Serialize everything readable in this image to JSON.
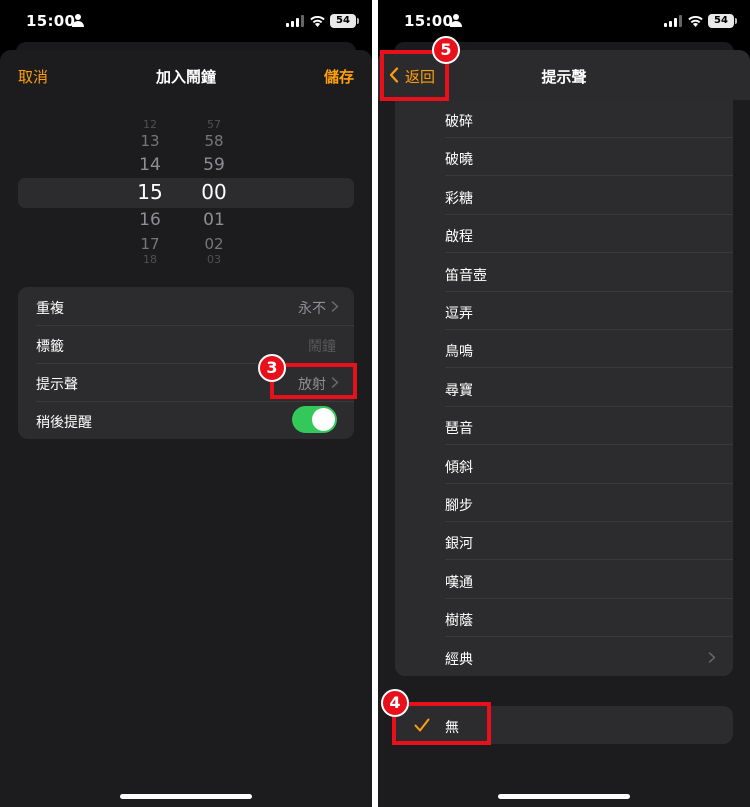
{
  "left": {
    "status": {
      "time": "15:00",
      "battery": "54"
    },
    "nav": {
      "cancel": "取消",
      "title": "加入鬧鐘",
      "save": "儲存"
    },
    "picker": {
      "hours": [
        "12",
        "13",
        "14",
        "15",
        "16",
        "17",
        "18"
      ],
      "minutes": [
        "57",
        "58",
        "59",
        "00",
        "01",
        "02",
        "03"
      ],
      "selected_hour": "15",
      "selected_minute": "00"
    },
    "settings": {
      "repeat": {
        "label": "重複",
        "value": "永不"
      },
      "label_row": {
        "label": "標籤",
        "placeholder": "鬧鐘"
      },
      "sound": {
        "label": "提示聲",
        "value": "放射"
      },
      "snooze": {
        "label": "稍後提醒",
        "on": true
      }
    },
    "annotation_3": "3"
  },
  "right": {
    "status": {
      "time": "15:00",
      "battery": "54"
    },
    "nav": {
      "back": "返回",
      "title": "提示聲"
    },
    "sounds": [
      "破碎",
      "破曉",
      "彩糖",
      "啟程",
      "笛音壺",
      "逗弄",
      "鳥鳴",
      "尋寶",
      "琶音",
      "傾斜",
      "腳步",
      "銀河",
      "嘆通",
      "樹蔭",
      "經典"
    ],
    "none_option": {
      "label": "無",
      "selected": true
    },
    "annotation_4": "4",
    "annotation_5": "5"
  },
  "colors": {
    "accent": "#ff9f0a",
    "toggle_on": "#34c759",
    "annotation": "#e8101a",
    "sheet_bg": "#1c1c1e",
    "cell_bg": "#2c2c2e"
  }
}
